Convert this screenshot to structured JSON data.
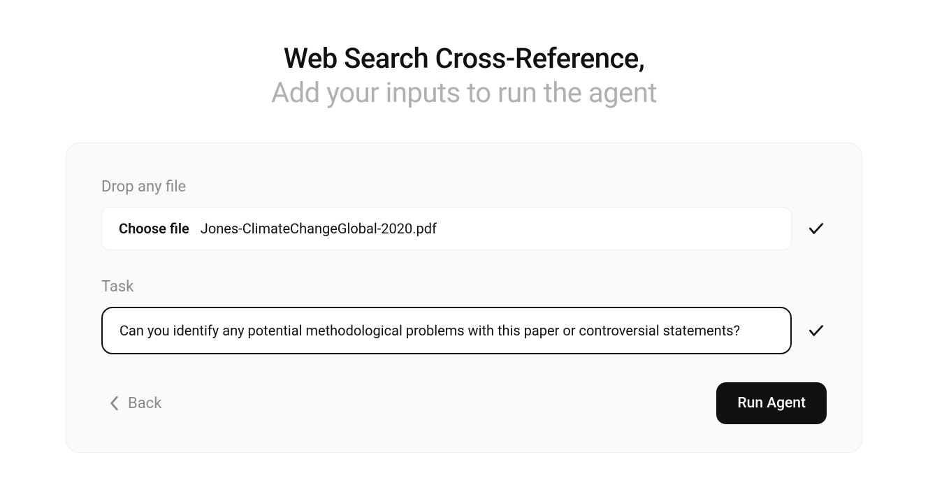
{
  "header": {
    "title": "Web Search Cross-Reference,",
    "subtitle": "Add your inputs to run the agent"
  },
  "form": {
    "file": {
      "label": "Drop any file",
      "choose_label": "Choose file",
      "filename": "Jones-ClimateChangeGlobal-2020.pdf"
    },
    "task": {
      "label": "Task",
      "value": "Can you identify any potential methodological problems with this paper or controversial statements?"
    }
  },
  "footer": {
    "back_label": "Back",
    "run_label": "Run Agent"
  }
}
